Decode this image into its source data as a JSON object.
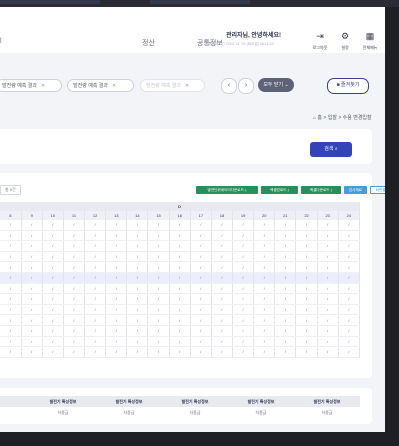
{
  "nav": {
    "settle": "정산",
    "common": "공통정보"
  },
  "user": {
    "greeting": "관리자님, 안녕하세요!",
    "last_login": "최종접속시간 2024. 11. 01 (화요일) 08:11:22"
  },
  "header_actions": [
    {
      "icon": "logout-icon",
      "glyph": "⇥",
      "label": "로그아웃"
    },
    {
      "icon": "gear-icon",
      "glyph": "⚙",
      "label": "설정"
    },
    {
      "icon": "grid-icon",
      "glyph": "▦",
      "label": "전체메뉴"
    }
  ],
  "tabs": [
    {
      "label": "발전량 예측 결과"
    },
    {
      "label": "발전량 예측 결과"
    },
    {
      "label": "발전량 예측 결과"
    }
  ],
  "close_all": "모두 닫기 ⌄",
  "bookmark": "즐겨찾기",
  "breadcrumb": {
    "home": "홈",
    "section": "입찰",
    "current": "수용 변경입찰"
  },
  "search": {
    "button": "검색"
  },
  "table": {
    "count": "총 5건",
    "buttons": [
      "발전단위데이터다운로드 ⤓",
      "엑셀업로드 ⤓",
      "엑셀다운로드 ⤓",
      "감사재료",
      "화면출력 ⧉"
    ],
    "d_header": "D",
    "hours": [
      "8",
      "9",
      "10",
      "11",
      "12",
      "13",
      "14",
      "15",
      "16",
      "17",
      "18",
      "19",
      "20",
      "21",
      "22",
      "23",
      "24"
    ],
    "cell_value": "/"
  },
  "bottom": {
    "header": "발전기 특성정보",
    "value": "차종급"
  }
}
